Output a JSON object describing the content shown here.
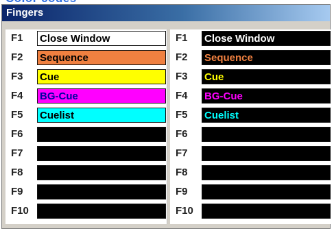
{
  "top_heading_partial": "Color codes",
  "window": {
    "title": "Fingers"
  },
  "left_panel": {
    "rows": [
      {
        "key": "F1",
        "label": "Close Window",
        "fill": "#ffffff",
        "text_color": "#000000"
      },
      {
        "key": "F2",
        "label": "Sequence",
        "fill": "#f08040",
        "text_color": "#000000"
      },
      {
        "key": "F3",
        "label": "Cue",
        "fill": "#ffff00",
        "text_color": "#000000"
      },
      {
        "key": "F4",
        "label": "BG-Cue",
        "fill": "#ff00ff",
        "text_color": "#0000a0"
      },
      {
        "key": "F5",
        "label": "Cuelist",
        "fill": "#00ffff",
        "text_color": "#000000"
      },
      {
        "key": "F6",
        "label": "",
        "fill": "#000000",
        "text_color": "#ffffff"
      },
      {
        "key": "F7",
        "label": "",
        "fill": "#000000",
        "text_color": "#ffffff"
      },
      {
        "key": "F8",
        "label": "",
        "fill": "#000000",
        "text_color": "#ffffff"
      },
      {
        "key": "F9",
        "label": "",
        "fill": "#000000",
        "text_color": "#ffffff"
      },
      {
        "key": "F10",
        "label": "",
        "fill": "#000000",
        "text_color": "#ffffff"
      }
    ]
  },
  "right_panel": {
    "rows": [
      {
        "key": "F1",
        "label": "Close Window",
        "fill": "#000000",
        "text_color": "#ffffff"
      },
      {
        "key": "F2",
        "label": "Sequence",
        "fill": "#000000",
        "text_color": "#f08040"
      },
      {
        "key": "F3",
        "label": "Cue",
        "fill": "#000000",
        "text_color": "#ffff00"
      },
      {
        "key": "F4",
        "label": "BG-Cue",
        "fill": "#000000",
        "text_color": "#ff00ff"
      },
      {
        "key": "F5",
        "label": "Cuelist",
        "fill": "#000000",
        "text_color": "#00ffff"
      },
      {
        "key": "F6",
        "label": "",
        "fill": "#000000",
        "text_color": "#ffffff"
      },
      {
        "key": "F7",
        "label": "",
        "fill": "#000000",
        "text_color": "#ffffff"
      },
      {
        "key": "F8",
        "label": "",
        "fill": "#000000",
        "text_color": "#ffffff"
      },
      {
        "key": "F9",
        "label": "",
        "fill": "#000000",
        "text_color": "#ffffff"
      },
      {
        "key": "F10",
        "label": "",
        "fill": "#000000",
        "text_color": "#ffffff"
      }
    ]
  }
}
